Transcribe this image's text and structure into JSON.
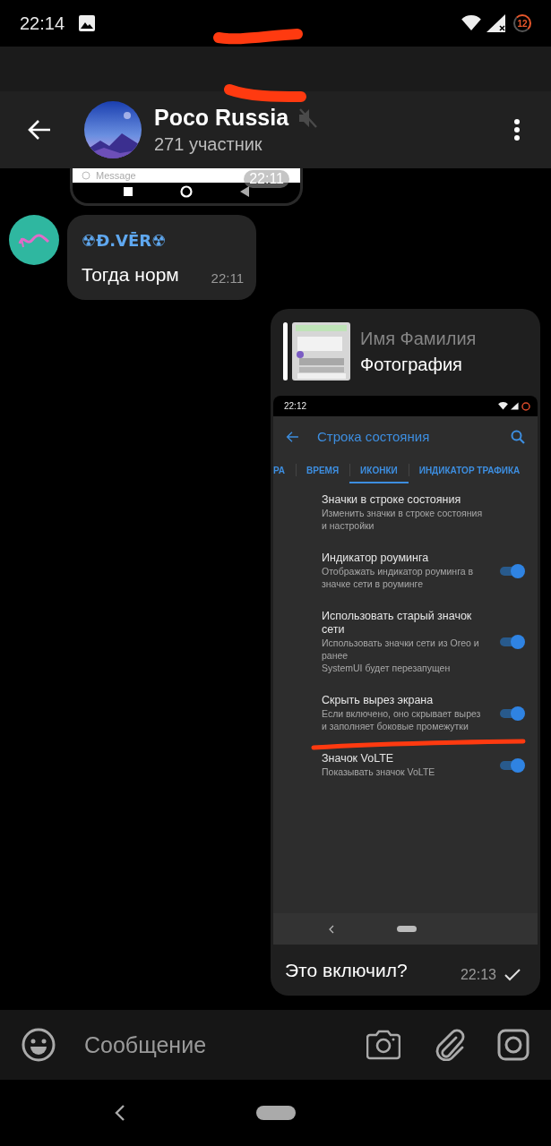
{
  "status_bar": {
    "time": "22:14",
    "battery": "12"
  },
  "chat": {
    "title": "Poco Russia",
    "subtitle": "271 участник",
    "muted": true
  },
  "messages": [
    {
      "kind": "image_tail",
      "placeholder": "Message",
      "time": "22:11"
    },
    {
      "kind": "incoming",
      "sender": "☢Đ.VĒR☢",
      "text": "Тогда норм",
      "time": "22:11"
    },
    {
      "kind": "outgoing",
      "reply": {
        "name": "Имя Фамилия",
        "text": "Фотография"
      },
      "screenshot": {
        "time": "22:12",
        "title": "Строка состояния",
        "tabs": [
          {
            "label": "РА",
            "selected": false
          },
          {
            "label": "ВРЕМЯ",
            "selected": false
          },
          {
            "label": "ИКОНКИ",
            "selected": true
          },
          {
            "label": "ИНДИКАТОР ТРАФИКА",
            "selected": false
          }
        ],
        "items": [
          {
            "kind": "link",
            "title": "Значки в строке состояния",
            "summary": "Изменить значки в строке состояния и настройки"
          },
          {
            "kind": "switch",
            "title": "Индикатор роуминга",
            "summary": "Отображать индикатор роуминга в значке сети в роуминге",
            "on": true
          },
          {
            "kind": "switch",
            "title": "Использовать старый значок сети",
            "summary": "Использовать значки сети из Oreo и ранее\nSystemUI будет перезапущен",
            "on": true
          },
          {
            "kind": "switch",
            "title": "Скрыть вырез экрана",
            "summary": "Если включено, оно скрывает вырез и заполняет боковые промежутки",
            "on": true
          },
          {
            "kind": "switch",
            "title": "Значок VoLTE",
            "summary": "Показывать значок VoLTE",
            "on": true
          }
        ]
      },
      "text": "Это включил?",
      "time": "22:13",
      "read": false
    }
  ],
  "composer": {
    "placeholder": "Сообщение"
  }
}
